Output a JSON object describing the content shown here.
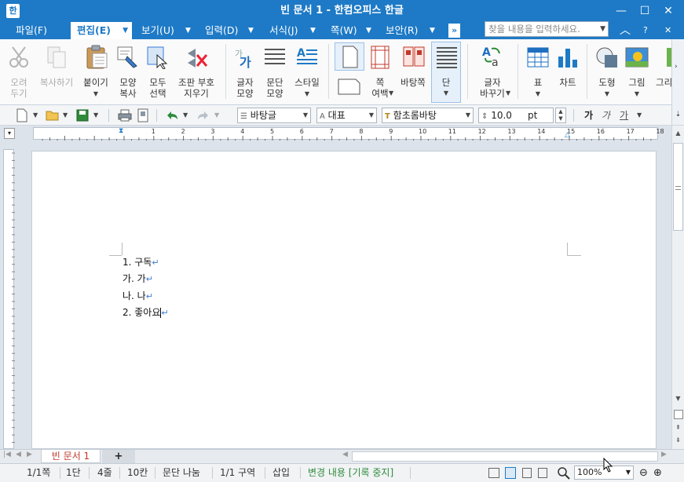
{
  "window": {
    "title": "빈 문서 1 - 한컴오피스 한글",
    "icon_label": "한",
    "minimize": "—",
    "maximize": "☐",
    "close": "✕"
  },
  "menu": {
    "items": [
      {
        "label": "파일(F)"
      },
      {
        "label": "편집(E)"
      },
      {
        "label": "보기(U)"
      },
      {
        "label": "입력(D)"
      },
      {
        "label": "서식(J)"
      },
      {
        "label": "쪽(W)"
      },
      {
        "label": "보안(R)"
      }
    ],
    "more": "»",
    "search_placeholder": "찾을 내용을 입력하세요.",
    "collapse": "︿",
    "help": "?",
    "close_doc": "✕"
  },
  "ribbon": {
    "cut": "오려\n두기",
    "copy": "복사하기",
    "paste": "붙이기",
    "format_copy": "모양\n복사",
    "select_all": "모두\n선택",
    "clear_format": "조판 부호\n지우기",
    "char_shape": "글자\n모양",
    "para_shape": "문단\n모양",
    "style": "스타일",
    "page_margin": "쪽\n여백",
    "background_page": "바탕쪽",
    "column": "단",
    "char_replace": "글자\n바꾸기",
    "table": "표",
    "chart": "차트",
    "shape": "도형",
    "picture": "그림",
    "drawing": "그리"
  },
  "toolbar": {
    "style_value": "바탕글",
    "lang_value": "대표",
    "font_value": "함초롬바탕",
    "size_value": "10.0",
    "size_unit": "pt",
    "bold": "가",
    "italic": "가",
    "underline": "가"
  },
  "ruler": {
    "numbers": [
      "1",
      "2",
      "3",
      "4",
      "5",
      "6",
      "7",
      "8",
      "9",
      "10",
      "11",
      "12",
      "13",
      "14",
      "15",
      "16",
      "17",
      "18"
    ]
  },
  "document": {
    "lines": [
      {
        "text": "1. 구독"
      },
      {
        "text": "가. 가"
      },
      {
        "text": "나. 나"
      },
      {
        "text": "2. 좋아요"
      }
    ],
    "para_mark": "↵"
  },
  "tabs": {
    "doc_tab": "빈 문서 1",
    "add": "+"
  },
  "status": {
    "page": "1/1쪽",
    "column": "1단",
    "line": "4줄",
    "col": "10칸",
    "split": "문단 나눔",
    "section": "1/1 구역",
    "mode": "삽입",
    "track": "변경 내용 [기록 중지]",
    "zoom": "100%"
  },
  "colors": {
    "title_blue": "#1e7ac6",
    "track_green": "#2e8b3a",
    "tab_red": "#c0392b"
  }
}
